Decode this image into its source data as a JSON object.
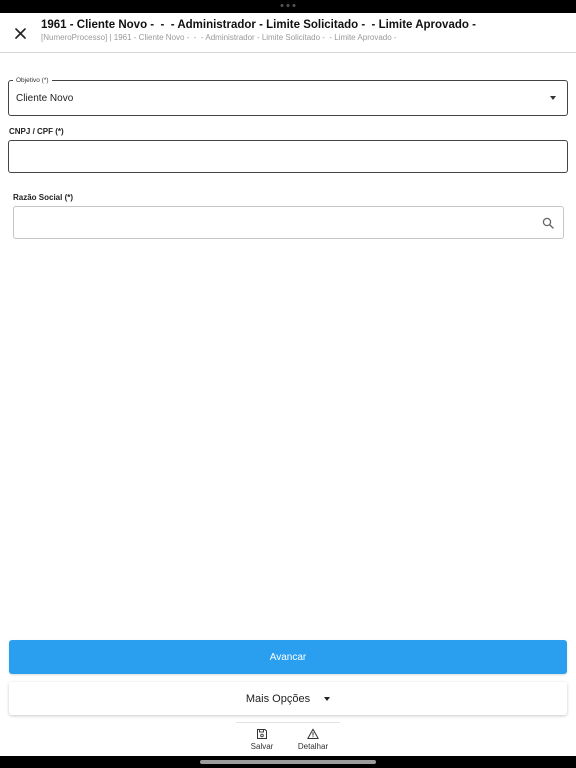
{
  "header": {
    "title": "1961 - Cliente Novo -  -  - Administrador - Limite Solicitado -  - Limite Aprovado -",
    "subtitle": "[NumeroProcesso] | 1961 - Cliente Novo -  -  - Administrador - Limite Solicitado -  - Limite Aprovado -"
  },
  "form": {
    "objetivo": {
      "label": "Objetivo (*)",
      "value": "Cliente Novo"
    },
    "cnpj": {
      "label": "CNPJ / CPF (*)",
      "value": ""
    },
    "razao_social": {
      "label": "Razão Social (*)",
      "value": ""
    }
  },
  "actions": {
    "avancar_label": "Avancar",
    "mais_opcoes_label": "Mais Opções"
  },
  "bottom_tabs": [
    {
      "label": "Salvar",
      "icon": "save-icon"
    },
    {
      "label": "Detalhar",
      "icon": "warning-icon"
    }
  ],
  "colors": {
    "primary": "#2a9ff0",
    "background": "#ffffff",
    "border": "#444444"
  }
}
